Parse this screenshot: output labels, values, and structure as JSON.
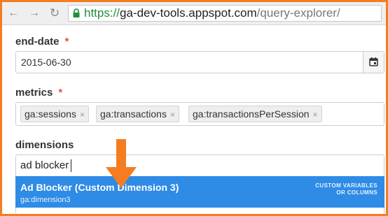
{
  "browser": {
    "url_scheme": "https://",
    "url_host": "ga-dev-tools.appspot.com",
    "url_path": "/query-explorer/",
    "back_icon": "arrow-left-icon",
    "forward_icon": "arrow-right-icon",
    "reload_icon": "reload-icon",
    "lock_icon": "lock-icon"
  },
  "form": {
    "end_date": {
      "label": "end-date",
      "required_mark": "*",
      "value": "2015-06-30",
      "icon": "calendar-icon"
    },
    "metrics": {
      "label": "metrics",
      "required_mark": "*",
      "tags": [
        "ga:sessions",
        "ga:transactions",
        "ga:transactionsPerSession"
      ],
      "remove_glyph": "×"
    },
    "dimensions": {
      "label": "dimensions",
      "value": "ad blocker",
      "suggestion": {
        "title": "Ad Blocker (Custom Dimension 3)",
        "id": "ga:dimension3",
        "category_line1": "CUSTOM VARIABLES",
        "category_line2": "OR COLUMNS"
      }
    }
  },
  "colors": {
    "accent_orange": "#f57d20",
    "highlight_blue": "#2e8be6",
    "required_red": "#d9534f",
    "url_green": "#1e8e3e"
  }
}
